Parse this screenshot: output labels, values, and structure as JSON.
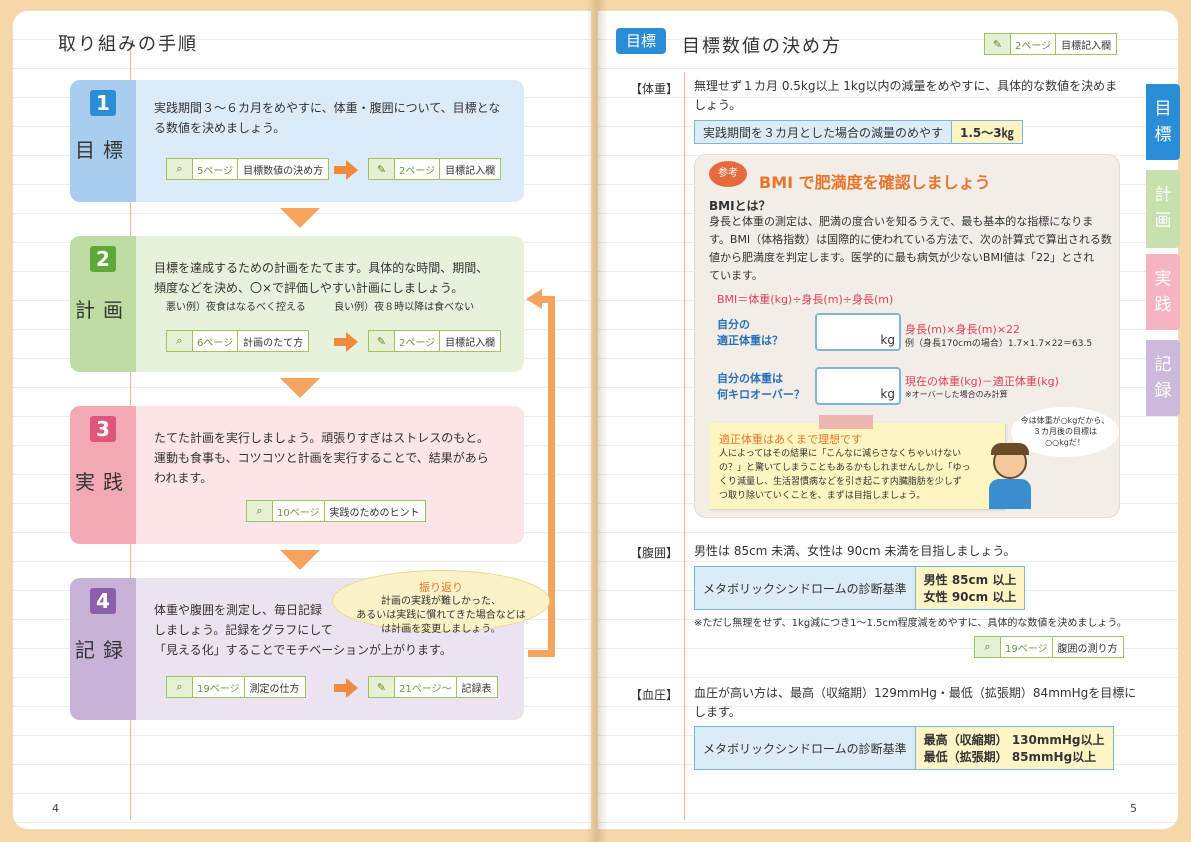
{
  "left": {
    "title": "取り組みの手順",
    "page_number": "4",
    "steps": [
      {
        "num": "1",
        "label": "目標",
        "text": [
          "実践期間３～６カ月をめやすに、体重・腹囲について、目標とな",
          "る数値を決めましょう。"
        ],
        "refs": [
          {
            "pg": "5ページ",
            "title": "目標数値の決め方"
          },
          {
            "pg": "2ページ",
            "title": "目標記入欄"
          }
        ]
      },
      {
        "num": "2",
        "label": "計画",
        "text": [
          "目標を達成するための計画をたてます。具体的な時間、期間、",
          "頻度などを決め、〇×で評価しやすい計画にしましょう。"
        ],
        "examples": [
          "悪い例）夜食はなるべく控える",
          "良い例）夜８時以降は食べない"
        ],
        "refs": [
          {
            "pg": "6ページ",
            "title": "計画のたて方"
          },
          {
            "pg": "2ページ",
            "title": "目標記入欄"
          }
        ]
      },
      {
        "num": "3",
        "label": "実践",
        "text": [
          "たてた計画を実行しましょう。頑張りすぎはストレスのもと。",
          "運動も食事も、コツコツと計画を実行することで、結果があら",
          "われます。"
        ],
        "refs": [
          {
            "pg": "10ページ",
            "title": "実践のためのヒント"
          }
        ]
      },
      {
        "num": "4",
        "label": "記録",
        "text": [
          "体重や腹囲を測定し、毎日記録",
          "しましょう。記録をグラフにして",
          "「見える化」することでモチベーションが上がります。"
        ],
        "refs": [
          {
            "pg": "19ページ",
            "title": "測定の仕方"
          },
          {
            "pg": "21ページ〜",
            "title": "記録表"
          }
        ]
      }
    ],
    "bubble": {
      "title": "振り返り",
      "lines": [
        "計画の実践が難しかった、",
        "あるいは実践に慣れてきた場合などは",
        "は計画を変更しましょう。"
      ]
    }
  },
  "right": {
    "header_tag": "目標",
    "title": "目標数値の決め方",
    "header_ref": {
      "pg": "2ページ",
      "title": "目標記入欄"
    },
    "page_number": "5",
    "weight": {
      "label": "【体重】",
      "text": [
        "無理せず１カ月 0.5kg以上 1kg以内の減量をめやすに、具体的な数値を決めま",
        "しょう。"
      ],
      "box_label": "実践期間を３カ月とした場合の減量のめやす",
      "box_value": "1.5～3㎏"
    },
    "bmi": {
      "badge": "参考",
      "title": "BMI で肥満度を確認しましょう",
      "subtitle": "BMIとは？",
      "text": [
        "身長と体重の測定は、肥満の度合いを知るうえで、最も基本的な指標になりま",
        "す。BMI（体格指数）は国際的に使われている方法で、次の計算式で算出される数",
        "値から肥満度を判定します。医学的に最も病気が少ないBMI値は「22」とされ",
        "ています。"
      ],
      "formula": "BMI＝体重(kg)÷身長(m)÷身長(m)",
      "q1": [
        "自分の",
        "適正体重は？"
      ],
      "q1_formula": "身長(m)×身長(m)×22",
      "q1_example": "例（身長170cmの場合）1.7×1.7×22＝63.5",
      "q2": [
        "自分の体重は",
        "何キロオーバー？"
      ],
      "q2_formula": "現在の体重(kg)－適正体重(kg)",
      "q2_note": "※オーバーした場合のみ計算",
      "unit": "kg",
      "note_title": "適正体重はあくまで理想です",
      "note_text": [
        "人によってはその結果に「こんなに減らさなくちゃいけない",
        "の？」と驚いてしまうこともあるかもしれませんしかし「ゆっ",
        "くり減量し、生活習慣病などを引き起こす内臓脂肪を少しず",
        "つ取り除いていくことを、まずは目指しましょう。"
      ],
      "speech": [
        "今は体重が○kgだから、",
        "３カ月後の目標は",
        "○○kgだ！"
      ]
    },
    "waist": {
      "label": "【腹囲】",
      "text": "男性は 85cm 未満、女性は 90cm 未満を目指しましょう。",
      "box_label": "メタボリックシンドロームの診断基準",
      "values": [
        "男性 85cm 以上",
        "女性 90cm 以上"
      ],
      "note": "※ただし無理をせず、1kg減につき1～1.5cm程度減をめやすに、具体的な数値を決めましょう。",
      "ref": {
        "pg": "19ページ",
        "title": "腹囲の測り方"
      }
    },
    "bp": {
      "label": "【血圧】",
      "text": [
        "血圧が高い方は、最高（収縮期）129mmHg・最低（拡張期）84mmHgを目標に",
        "します。"
      ],
      "box_label": "メタボリックシンドロームの診断基準",
      "values": [
        "最高（収縮期） 130mmHg以上",
        "最低（拡張期） 85mmHg以上"
      ]
    },
    "side_tabs": [
      "目標",
      "計画",
      "実践",
      "記録"
    ]
  },
  "colors": {
    "step1": "#dcebf8",
    "step2": "#e7f2dc",
    "step3": "#fde4e6",
    "step4": "#ece3f1",
    "orange": "#f6a35e"
  }
}
